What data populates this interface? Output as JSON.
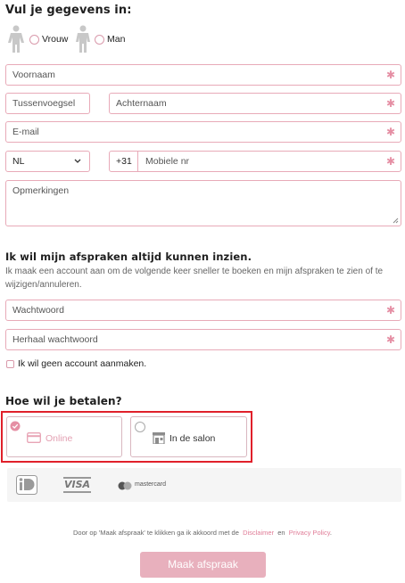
{
  "form": {
    "title": "Vul je gegevens in:",
    "gender": {
      "option1": "Vrouw",
      "option2": "Man"
    },
    "fields": {
      "first_name": "Voornaam",
      "middle_name": "Tussenvoegsel",
      "last_name": "Achternaam",
      "email": "E-mail",
      "country": "NL",
      "phone_prefix": "+31",
      "mobile": "Mobiele nr",
      "remarks": "Opmerkingen"
    },
    "required_marker": "✱"
  },
  "account": {
    "title": "Ik wil mijn afspraken altijd kunnen inzien.",
    "description": "Ik maak een account aan om de volgende keer sneller te boeken en mijn afspraken te zien of te wijzigen/annuleren.",
    "password": "Wachtwoord",
    "repeat_password": "Herhaal wachtwoord",
    "no_account_label": "Ik wil geen account aanmaken."
  },
  "payment": {
    "title": "Hoe wil je betalen?",
    "options": [
      {
        "label": "Online",
        "selected": true
      },
      {
        "label": "In de salon",
        "selected": false
      }
    ],
    "logos": {
      "visa": "VISA",
      "mastercard": "mastercard"
    }
  },
  "terms": {
    "prefix": "Door op 'Maak afspraak' te klikken ga ik akkoord met de",
    "disclaimer": "Disclaimer",
    "and": "en",
    "privacy": "Privacy Policy",
    "suffix": "."
  },
  "submit_label": "Maak afspraak",
  "colors": {
    "accent": "#e58fa4",
    "border": "#e8aab8",
    "highlight": "#e0202a",
    "button": "#e8b0bd"
  }
}
